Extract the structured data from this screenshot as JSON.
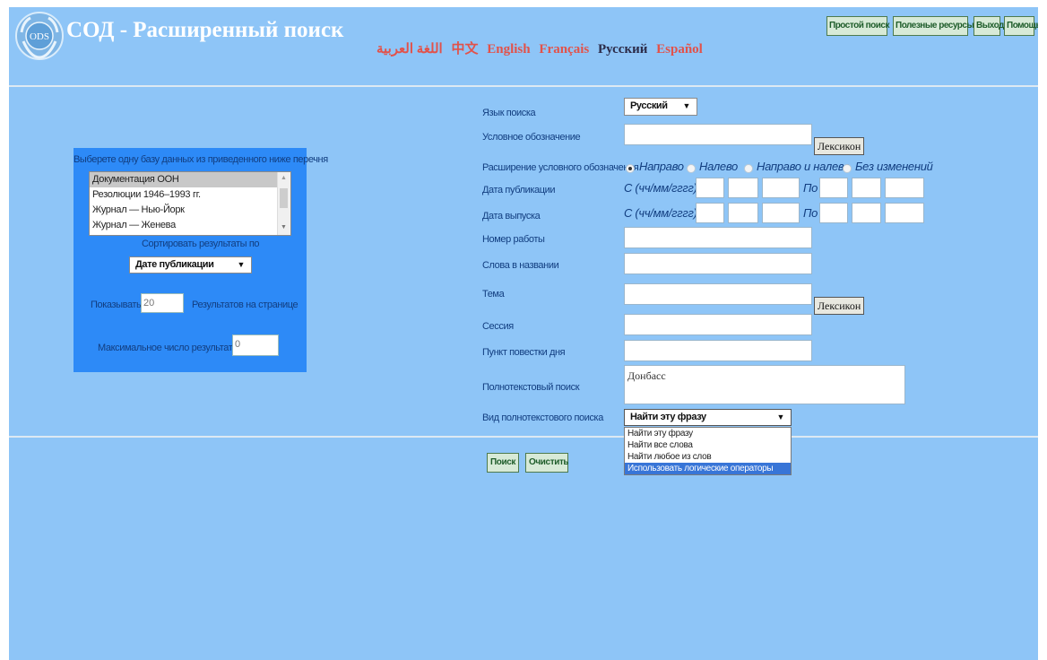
{
  "header": {
    "logo_text": "ODS",
    "title": "СОД - Расширенный поиск",
    "top_buttons": [
      "Простой поиск",
      "Полезные ресурсы",
      "Выход",
      "Помощь"
    ],
    "languages": [
      "اللغة العربية",
      "中文",
      "English",
      "Français",
      "Русский",
      "Español"
    ],
    "current_language": "Русский"
  },
  "left_panel": {
    "db_prompt": "Выберете одну базу данных из приведенного ниже перечня",
    "databases": [
      "Документация ООН",
      "Резолюции 1946–1993 гг.",
      "Журнал — Нью-Йорк",
      "Журнал — Женева"
    ],
    "sort_label": "Сортировать результаты по",
    "sort_value": "Дате публикации",
    "show_label": "Показывать",
    "per_page_value": "20",
    "per_page_suffix": "Результатов на странице",
    "max_results_label": "Максимальное число результатов",
    "max_results_value": "0"
  },
  "form": {
    "search_language_label": "Язык поиска",
    "search_language_value": "Русский",
    "symbol_label": "Условное обозначение",
    "lexicon_label": "Лексикон",
    "symbol_ext_label": "Расширение условного обозначения",
    "symbol_ext_options": [
      "Направо",
      "Налево",
      "Направо и налево",
      "Без изменений"
    ],
    "pub_date_label": "Дата публикации",
    "release_date_label": "Дата выпуска",
    "from_label": "С (чч/мм/гггг)",
    "to_label": "По",
    "job_number_label": "Номер работы",
    "title_words_label": "Слова в названии",
    "subject_label": "Тема",
    "session_label": "Сессия",
    "agenda_label": "Пункт повестки дня",
    "fulltext_label": "Полнотекстовый поиск",
    "fulltext_value": "Донбасс",
    "fulltext_type_label": "Вид полнотекстового поиска",
    "fulltext_type_value": "Найти эту фразу",
    "fulltext_type_options": [
      "Найти эту фразу",
      "Найти все слова",
      "Найти любое из слов",
      "Использовать логические операторы"
    ]
  },
  "actions": {
    "search_label": "Поиск",
    "clear_label": "Очистить"
  },
  "colors": {
    "page_bg": "#8ec5f7",
    "panel_bg": "#2d8af7",
    "lang_link": "#e2524a",
    "button_bg": "#d7ead7",
    "highlight": "#3875d7"
  }
}
